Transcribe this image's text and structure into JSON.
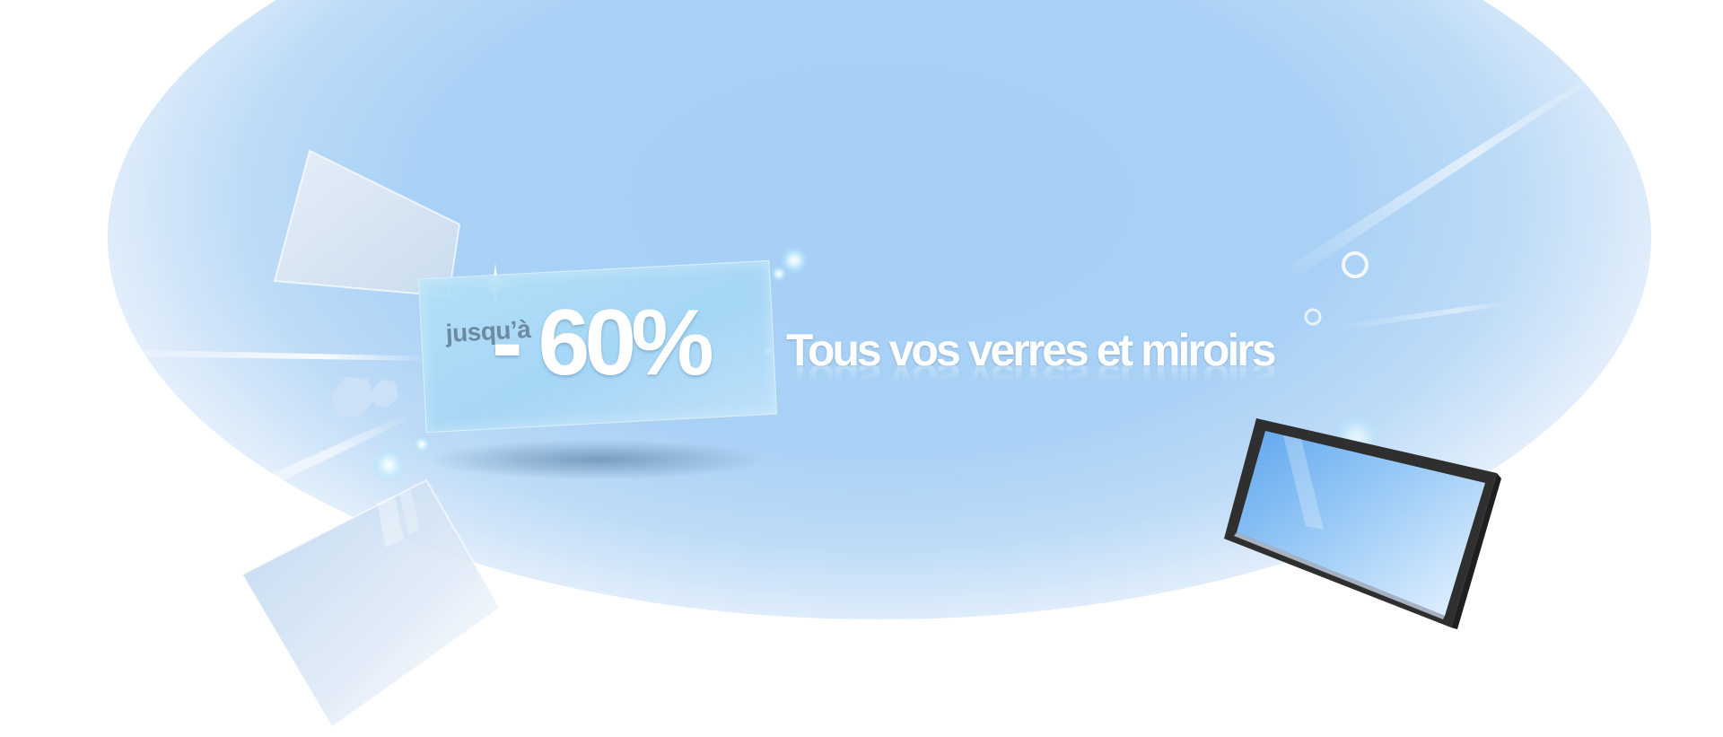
{
  "promo": {
    "upto_label": "jusqu’à",
    "discount": "- 60%"
  },
  "headline": {
    "text": "Tous vos verres et miroirs"
  },
  "colors": {
    "sky_blue": "#a7d0f5",
    "card_blue": "#b2e0f8",
    "frame_dark": "#2f2f2f",
    "mirror_blue": "#6fb0ee",
    "label_gray": "#6e8aa0"
  },
  "icons": {
    "framed_mirror": "framed-mirror-icon",
    "glass_panel_top": "glass-panel-icon",
    "glass_panel_bottom": "glass-panel-icon",
    "sparkle": "sparkle-icon",
    "bubble": "bubble-icon",
    "hexagon": "hexagon-icon",
    "light_streak": "light-streak-icon"
  }
}
